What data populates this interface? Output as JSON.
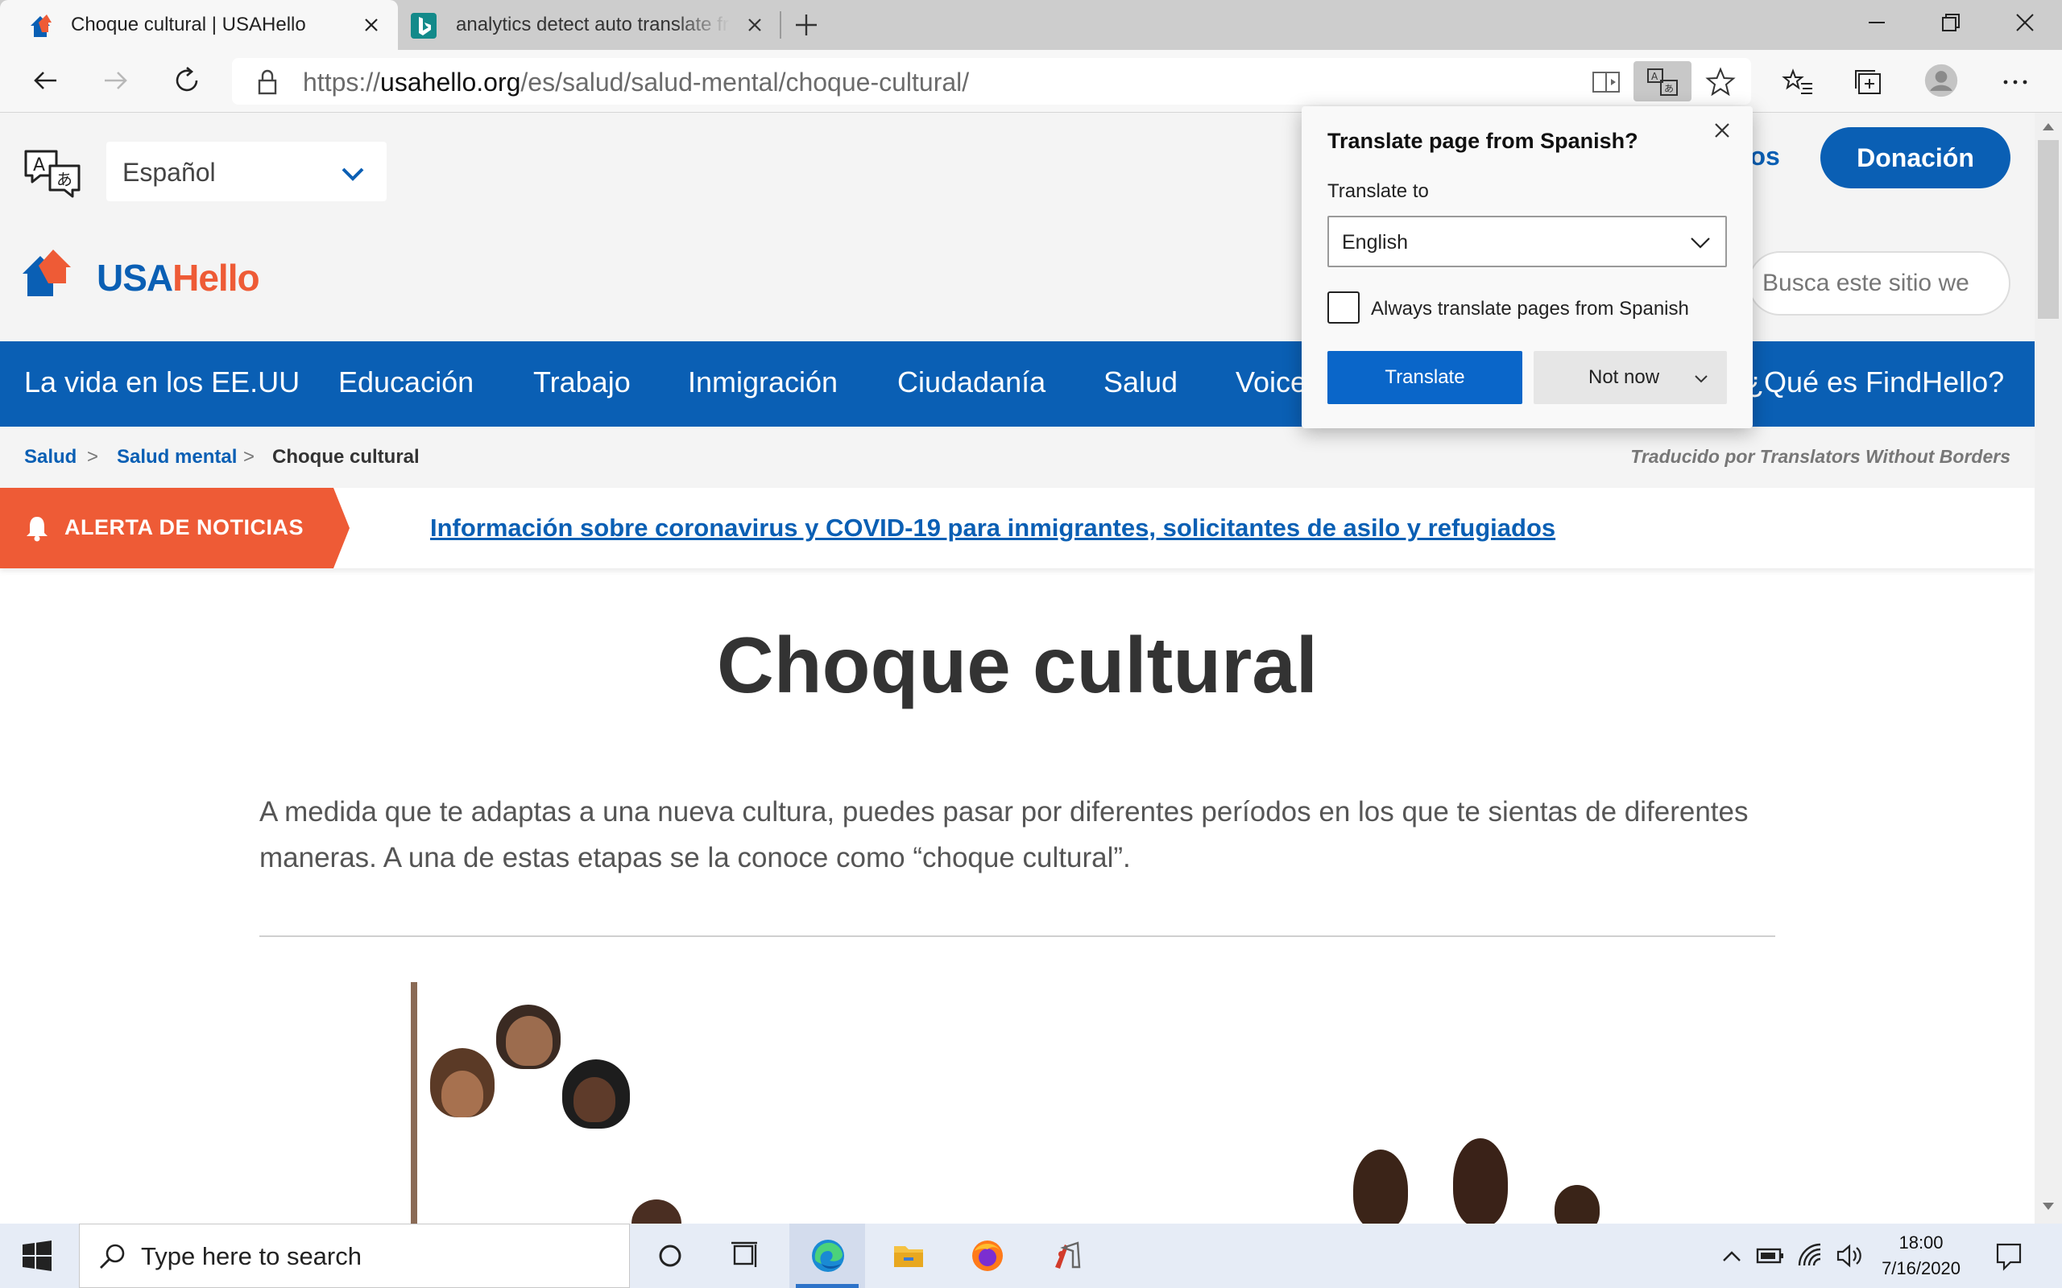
{
  "browser": {
    "tabs": [
      {
        "title": "Choque cultural | USAHello",
        "active": true
      },
      {
        "title": "analytics detect auto translate from",
        "active": false
      }
    ],
    "url": {
      "scheme": "https://",
      "host": "usahello.org",
      "path": "/es/salud/salud-mental/choque-cultural/"
    }
  },
  "site": {
    "language": "Español",
    "brand_a": "USA",
    "brand_b": "Hello",
    "nosotros_fragment": "ros",
    "donate": "Donación",
    "search_placeholder": "Busca este sitio we",
    "nav": [
      "La vida en los EE.UU",
      "Educación",
      "Trabajo",
      "Inmigración",
      "Ciudadanía",
      "Salud",
      "Voice",
      "¿Qué es FindHello?"
    ],
    "breadcrumb": [
      "Salud",
      "Salud mental",
      "Choque cultural"
    ],
    "breadcrumb_sep": ">",
    "credit": "Traducido por Translators Without Borders",
    "alert_label": "ALERTA DE NOTICIAS",
    "alert_link": "Información sobre coronavirus y COVID-19 para inmigrantes, solicitantes de asilo y refugiados",
    "page_title": "Choque cultural",
    "intro": "A medida que te adaptas a una nueva cultura, puedes pasar por diferentes períodos en los que te sientas de diferentes maneras. A una de estas etapas se la conoce como “choque cultural”."
  },
  "translate_popup": {
    "title": "Translate page from Spanish?",
    "to_label": "Translate to",
    "selected_language": "English",
    "always_label": "Always translate pages from Spanish",
    "always_checked": false,
    "translate_button": "Translate",
    "not_now_button": "Not now"
  },
  "taskbar": {
    "search_placeholder": "Type here to search",
    "time": "18:00",
    "date": "7/16/2020"
  },
  "colors": {
    "brand_blue": "#0a5fb4",
    "brand_orange": "#ee5b36",
    "edge_blue": "#0a66c9"
  }
}
